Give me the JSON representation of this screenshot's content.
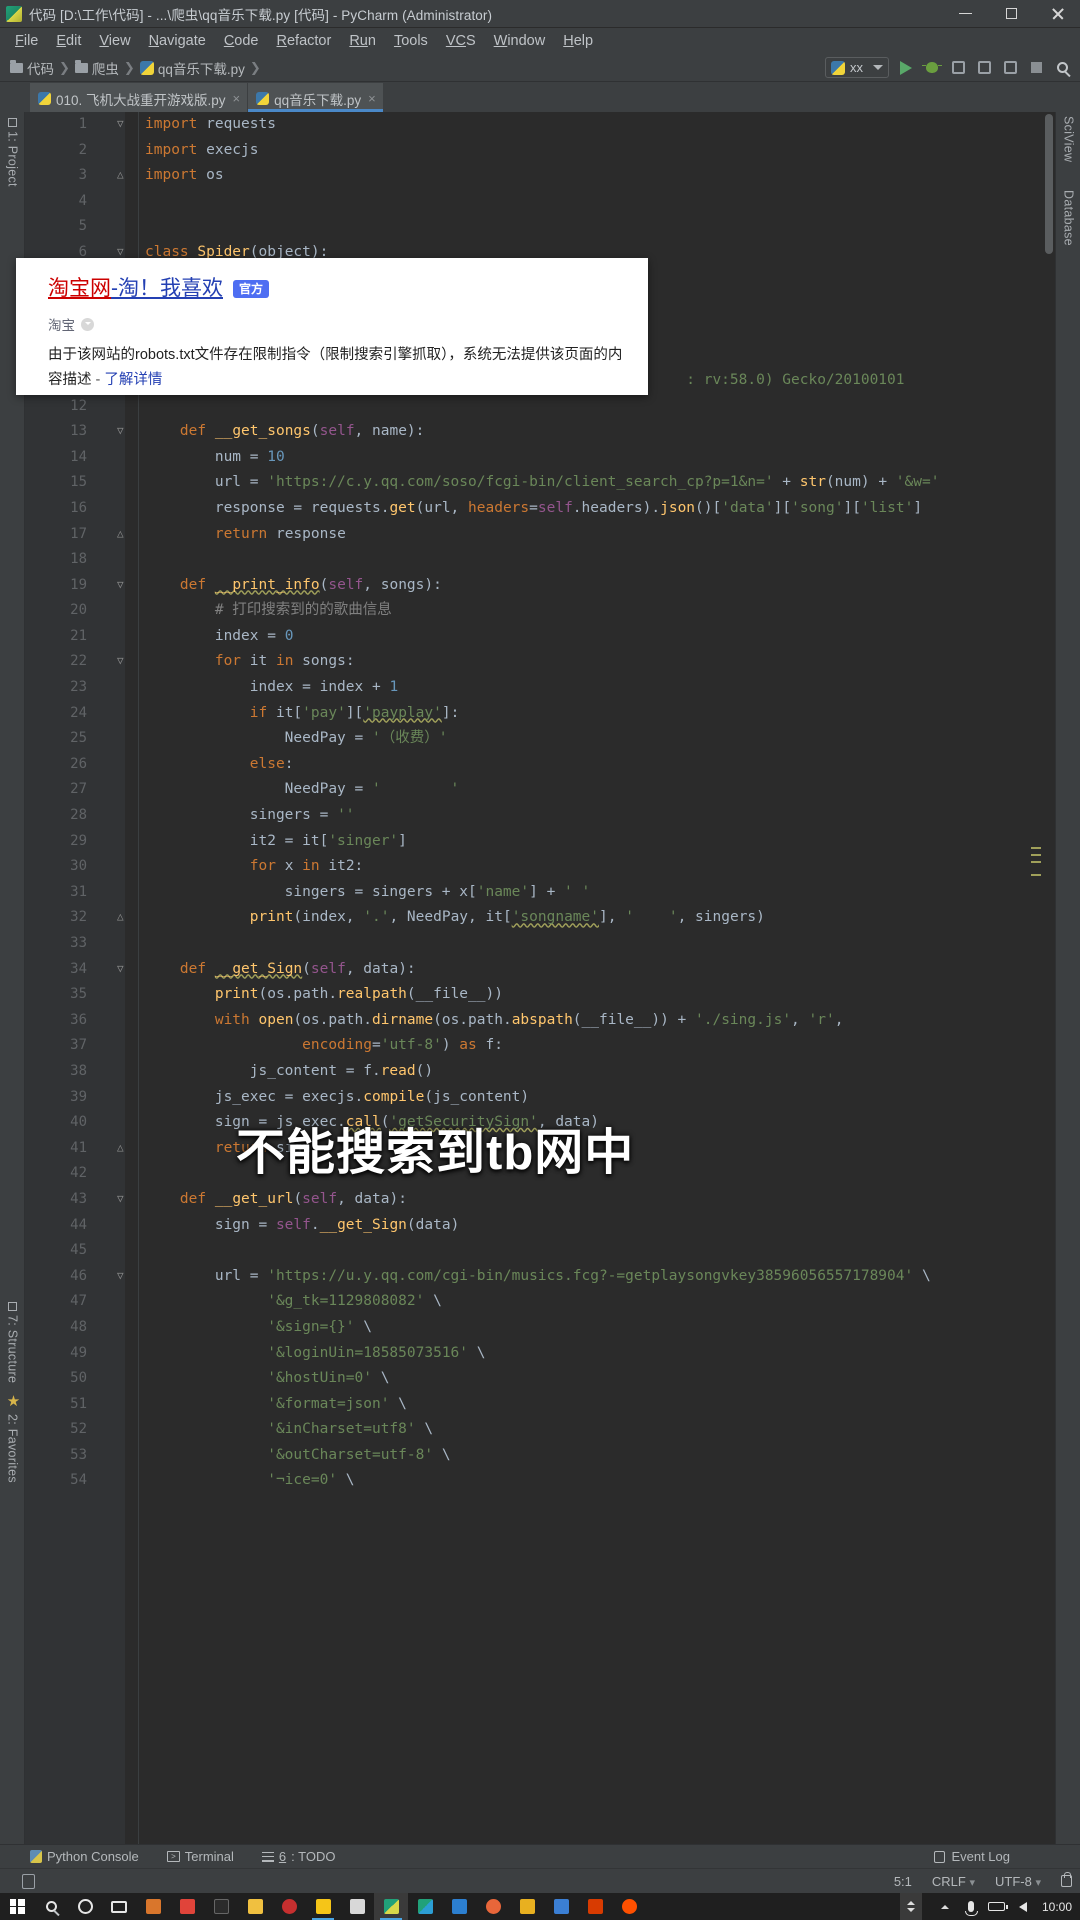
{
  "window": {
    "title": "代码 [D:\\工作\\代码] - ...\\爬虫\\qq音乐下载.py [代码] - PyCharm (Administrator)",
    "app_icon": "pycharm-icon",
    "minimize": "minimize-icon",
    "maximize": "maximize-icon",
    "close": "close-icon"
  },
  "menu": {
    "items": [
      {
        "mn": "F",
        "rest": "ile"
      },
      {
        "mn": "E",
        "rest": "dit"
      },
      {
        "mn": "V",
        "rest": "iew"
      },
      {
        "mn": "N",
        "rest": "avigate"
      },
      {
        "mn": "C",
        "rest": "ode"
      },
      {
        "mn": "R",
        "rest": "efactor"
      },
      {
        "mn": "Ru",
        "rest": "n"
      },
      {
        "mn": "T",
        "rest": "ools"
      },
      {
        "mn": "VC",
        "rest": "S"
      },
      {
        "mn": "W",
        "rest": "indow"
      },
      {
        "mn": "H",
        "rest": "elp"
      }
    ]
  },
  "breadcrumb": {
    "items": [
      "代码",
      "爬虫",
      "qq音乐下载.py"
    ],
    "sep": "❯"
  },
  "run_config": {
    "name": "xx",
    "dropdown": "chevron-down-icon",
    "run": "run-button",
    "debug": "debug-button",
    "coverage": "coverage-button",
    "profile": "profile-button",
    "stop": "stop-button",
    "search": "search-button"
  },
  "tabs": [
    {
      "label": "010. 飞机大战重开游戏版.py",
      "active": false,
      "close": "×"
    },
    {
      "label": "qq音乐下载.py",
      "active": true,
      "close": "×"
    }
  ],
  "left_strip": [
    {
      "label": "1: Project",
      "icon": "project-icon"
    },
    {
      "label": "7: Structure",
      "icon": "structure-icon"
    },
    {
      "label": "2: Favorites",
      "icon": "favorites-star-icon"
    }
  ],
  "right_strip": [
    {
      "label": "SciView",
      "icon": "sciview-icon"
    },
    {
      "label": "Database",
      "icon": "database-icon"
    }
  ],
  "popup": {
    "title_red": "淘宝网",
    "title_dash": " - ",
    "title_blue": "淘！我喜欢",
    "badge": "官方",
    "source": "淘宝",
    "source_chevron": "chevron-down-circle-icon",
    "desc_line1": "由于该网站的robots.txt文件存在限制指令（限制搜索引擎抓取），系统无法提供该页面的内容描",
    "desc_line2_prefix": "述",
    "desc_dash": " - ",
    "desc_link": "了解详情"
  },
  "annotation": {
    "text": "不能搜索到tb网中"
  },
  "code_lines": [
    {
      "n": 1,
      "fold": "▽",
      "html": "<span class='kw'>import</span> requests"
    },
    {
      "n": 2,
      "fold": "",
      "html": "<span class='kw'>import</span> execjs"
    },
    {
      "n": 3,
      "fold": "△",
      "html": "<span class='kw'>import</span> os"
    },
    {
      "n": 4,
      "fold": "",
      "html": ""
    },
    {
      "n": 5,
      "fold": "",
      "html": ""
    },
    {
      "n": 6,
      "fold": "▽",
      "html": "<span class='kw'>class</span> <span class='fn'>Spider</span>(<span class='par'>object</span>):"
    },
    {
      "n": 7,
      "fold": "",
      "html": ""
    },
    {
      "n": 8,
      "fold": "",
      "html": ""
    },
    {
      "n": 9,
      "fold": "",
      "html": ""
    },
    {
      "n": 10,
      "fold": "",
      "html": ""
    },
    {
      "n": 11,
      "fold": "",
      "html": "                                                              <span class='str'>: rv:58.0) Gecko/20100101</span>"
    },
    {
      "n": 12,
      "fold": "",
      "html": ""
    },
    {
      "n": 13,
      "fold": "▽",
      "html": "    <span class='kw'>def</span> <span class='fn'>__get_songs</span>(<span class='slf'>self</span>, name):"
    },
    {
      "n": 14,
      "fold": "",
      "html": "        num = <span class='num'>10</span>"
    },
    {
      "n": 15,
      "fold": "",
      "html": "        url = <span class='str'>'https://c.y.qq.com/soso/fcgi-bin/client_search_cp?p=1&n='</span> + <span class='fn'>str</span>(num) + <span class='str'>'&w='</span>"
    },
    {
      "n": 16,
      "fold": "",
      "html": "        response = requests.<span class='fn'>get</span>(url, <span class='kw'>headers</span>=<span class='slf'>self</span>.headers).<span class='fn'>json</span>()[<span class='str'>'data'</span>][<span class='str'>'song'</span>][<span class='str'>'list'</span>]"
    },
    {
      "n": 17,
      "fold": "△",
      "html": "        <span class='kw'>return</span> response"
    },
    {
      "n": 18,
      "fold": "",
      "html": ""
    },
    {
      "n": 19,
      "fold": "▽",
      "html": "    <span class='kw'>def</span> <span class='fn err'>__print_info</span>(<span class='slf'>self</span>, songs):"
    },
    {
      "n": 20,
      "fold": "",
      "html": "        <span class='cmt'># 打印搜索到的的歌曲信息</span>"
    },
    {
      "n": 21,
      "fold": "",
      "html": "        index = <span class='num'>0</span>"
    },
    {
      "n": 22,
      "fold": "▽",
      "html": "        <span class='kw'>for</span> it <span class='kw'>in</span> songs:"
    },
    {
      "n": 23,
      "fold": "",
      "html": "            index = index + <span class='num'>1</span>"
    },
    {
      "n": 24,
      "fold": "",
      "html": "            <span class='kw'>if</span> it[<span class='str'>'pay'</span>][<span class='str err'>'payplay'</span>]:"
    },
    {
      "n": 25,
      "fold": "",
      "html": "                NeedPay = <span class='str'>'（收费）'</span>"
    },
    {
      "n": 26,
      "fold": "",
      "html": "            <span class='kw'>else</span>:"
    },
    {
      "n": 27,
      "fold": "",
      "html": "                NeedPay = <span class='str'>'        '</span>"
    },
    {
      "n": 28,
      "fold": "",
      "html": "            singers = <span class='str'>''</span>"
    },
    {
      "n": 29,
      "fold": "",
      "html": "            it2 = it[<span class='str'>'singer'</span>]"
    },
    {
      "n": 30,
      "fold": "",
      "html": "            <span class='kw'>for</span> x <span class='kw'>in</span> it2:"
    },
    {
      "n": 31,
      "fold": "",
      "html": "                singers = singers + x[<span class='str'>'name'</span>] + <span class='str'>' '</span>"
    },
    {
      "n": 32,
      "fold": "△",
      "html": "            <span class='fn'>print</span>(index, <span class='str'>'.'</span>, NeedPay, it[<span class='str err'>'songname'</span>], <span class='str'>'    '</span>, singers)"
    },
    {
      "n": 33,
      "fold": "",
      "html": ""
    },
    {
      "n": 34,
      "fold": "▽",
      "html": "    <span class='kw'>def</span> <span class='fn err'>__get_Sign</span>(<span class='slf'>self</span>, data):"
    },
    {
      "n": 35,
      "fold": "",
      "html": "        <span class='fn'>print</span>(os.path.<span class='fn'>realpath</span>(__file__))"
    },
    {
      "n": 36,
      "fold": "",
      "html": "        <span class='kw'>with</span> <span class='fn'>open</span>(os.path.<span class='fn'>dirname</span>(os.path.<span class='fn'>abspath</span>(__file__)) + <span class='str'>'./sing.js'</span>, <span class='str'>'r'</span>,"
    },
    {
      "n": 37,
      "fold": "",
      "html": "                  <span class='kw'>encoding</span>=<span class='str'>'utf-8'</span>) <span class='kw'>as</span> f:"
    },
    {
      "n": 38,
      "fold": "",
      "html": "            js_content = f.<span class='fn'>read</span>()"
    },
    {
      "n": 39,
      "fold": "",
      "html": "        js_exec = execjs.<span class='fn'>compile</span>(js_content)"
    },
    {
      "n": 40,
      "fold": "",
      "html": "        sign = js_exec.<span class='fn err'>call</span>(<span class='str err'>'getSecuritySign'</span>, data)"
    },
    {
      "n": 41,
      "fold": "△",
      "html": "        <span class='kw'>return</span> sign"
    },
    {
      "n": 42,
      "fold": "",
      "html": ""
    },
    {
      "n": 43,
      "fold": "▽",
      "html": "    <span class='kw'>def</span> <span class='fn'>__get_url</span>(<span class='slf'>self</span>, data):"
    },
    {
      "n": 44,
      "fold": "",
      "html": "        sign = <span class='slf'>self</span>.<span class='fn'>__get_Sign</span>(data)"
    },
    {
      "n": 45,
      "fold": "",
      "html": ""
    },
    {
      "n": 46,
      "fold": "▽",
      "html": "        url = <span class='str'>'https://u.y.qq.com/cgi-bin/musics.fcg?-=getplaysongvkey38596056557178904'</span> \\"
    },
    {
      "n": 47,
      "fold": "",
      "html": "              <span class='str'>'&g_tk=1129808082'</span> \\"
    },
    {
      "n": 48,
      "fold": "",
      "html": "              <span class='str'>'&sign={}'</span> \\"
    },
    {
      "n": 49,
      "fold": "",
      "html": "              <span class='str'>'&loginUin=18585073516'</span> \\"
    },
    {
      "n": 50,
      "fold": "",
      "html": "              <span class='str'>'&hostUin=0'</span> \\"
    },
    {
      "n": 51,
      "fold": "",
      "html": "              <span class='str'>'&format=json'</span> \\"
    },
    {
      "n": 52,
      "fold": "",
      "html": "              <span class='str'>'&inCharset=utf8'</span> \\"
    },
    {
      "n": 53,
      "fold": "",
      "html": "              <span class='str'>'&outCharset=utf-8'</span> \\"
    },
    {
      "n": 54,
      "fold": "",
      "html": "              <span class='str'>'&notice=0'</span> \\"
    }
  ],
  "bottom_bar": {
    "items": [
      {
        "label": "Python Console",
        "icon": "python-console-icon"
      },
      {
        "label": "Terminal",
        "icon": "terminal-icon"
      },
      {
        "label_mn": "6",
        "label": ": TODO",
        "icon": "todo-icon"
      }
    ],
    "event_log": "Event Log",
    "event_log_icon": "event-log-icon"
  },
  "status_bar": {
    "left_icon": "mobile-preview-icon",
    "caret": "5:1",
    "line_sep": "CRLF",
    "encoding": "UTF-8",
    "lock_icon": "lock-icon",
    "sep_caret": "▾"
  },
  "taskbar": {
    "start": "windows-start-icon",
    "search": "search-icon",
    "cortana": "cortana-icon",
    "taskview": "task-view-icon",
    "apps": [
      {
        "name": "pdf-reader-icon",
        "color": "#d9762c"
      },
      {
        "name": "diamond-app-icon",
        "color": "#e0443a"
      },
      {
        "name": "terminal-app-icon",
        "color": "#2b2b2b"
      },
      {
        "name": "dict-app-icon",
        "color": "#f0c040"
      },
      {
        "name": "netease-music-icon",
        "color": "#c62f2f"
      },
      {
        "name": "thunder-icon",
        "color": "#f5c518"
      },
      {
        "name": "text-editor-icon",
        "color": "#d8d8d8"
      },
      {
        "name": "pycharm-icon",
        "color": "#21a179"
      },
      {
        "name": "clion-icon",
        "color": "#21a179"
      },
      {
        "name": "vscode-icon",
        "color": "#2c7fd0"
      },
      {
        "name": "opera-icon",
        "color": "#e8663a"
      },
      {
        "name": "vmware-icon",
        "color": "#e8b020"
      },
      {
        "name": "downloader-icon",
        "color": "#3b7fd4"
      },
      {
        "name": "office-icon",
        "color": "#d83b01"
      },
      {
        "name": "taobao-icon",
        "color": "#ff5000"
      }
    ],
    "tray": {
      "show_hidden": "chevron-up-icon",
      "mic": "microphone-icon",
      "battery": "battery-icon",
      "volume": "volume-icon",
      "clock": "10:00"
    }
  }
}
